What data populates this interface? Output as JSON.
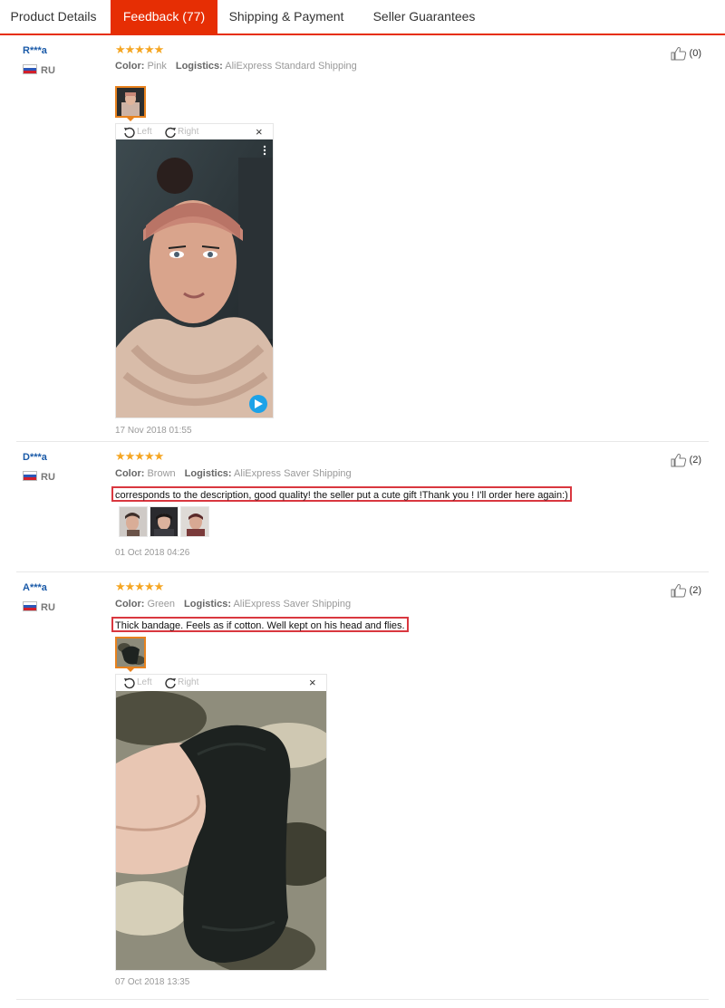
{
  "tabs": [
    {
      "label": "Product Details"
    },
    {
      "label": "Feedback (77)"
    },
    {
      "label": "Shipping & Payment"
    },
    {
      "label": "Seller Guarantees"
    }
  ],
  "colors": {
    "accent": "#e62e04",
    "star": "#f5a623",
    "username": "#1a5aa8",
    "highlight_box": "#d9373f",
    "thumb_selected": "#e8821e"
  },
  "reviews": [
    {
      "user": "R***a",
      "country": "RU",
      "stars": "★★★★★",
      "color_label": "Color:",
      "color_value": "Pink",
      "logistics_label": "Logistics:",
      "logistics_value": "AliExpress Standard Shipping",
      "helpful": "(0)",
      "date": "17 Nov 2018 01:55",
      "viewer": {
        "left": "Left",
        "right": "Right",
        "close": "×"
      }
    },
    {
      "user": "D***a",
      "country": "RU",
      "stars": "★★★★★",
      "color_label": "Color:",
      "color_value": "Brown",
      "logistics_label": "Logistics:",
      "logistics_value": "AliExpress Saver Shipping",
      "text": "corresponds to the description, good quality! the seller put a cute gift !Thank you ! I'll order here again:)",
      "helpful": "(2)",
      "date": "01 Oct 2018 04:26"
    },
    {
      "user": "A***a",
      "country": "RU",
      "stars": "★★★★★",
      "color_label": "Color:",
      "color_value": "Green",
      "logistics_label": "Logistics:",
      "logistics_value": "AliExpress Saver Shipping",
      "text": "Thick bandage. Feels as if cotton. Well kept on his head and flies.",
      "helpful": "(2)",
      "date": "07 Oct 2018 13:35",
      "viewer": {
        "left": "Left",
        "right": "Right",
        "close": "×"
      }
    }
  ]
}
